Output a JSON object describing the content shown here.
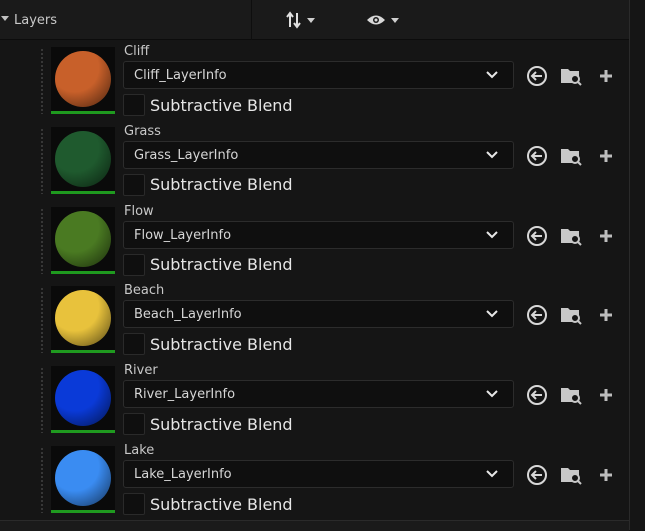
{
  "header": {
    "title": "Layers",
    "sort_icon": "sort-arrows-icon",
    "visibility_icon": "eye-icon"
  },
  "layers": [
    {
      "name": "Cliff",
      "layer_info": "Cliff_LayerInfo",
      "checkbox_label": "Subtractive Blend",
      "subtractive_blend": false,
      "color": "#c8602a"
    },
    {
      "name": "Grass",
      "layer_info": "Grass_LayerInfo",
      "checkbox_label": "Subtractive Blend",
      "subtractive_blend": false,
      "color": "#1f5a2e"
    },
    {
      "name": "Flow",
      "layer_info": "Flow_LayerInfo",
      "checkbox_label": "Subtractive Blend",
      "subtractive_blend": false,
      "color": "#4a7a22"
    },
    {
      "name": "Beach",
      "layer_info": "Beach_LayerInfo",
      "checkbox_label": "Subtractive Blend",
      "subtractive_blend": false,
      "color": "#e8c23c"
    },
    {
      "name": "River",
      "layer_info": "River_LayerInfo",
      "checkbox_label": "Subtractive Blend",
      "subtractive_blend": false,
      "color": "#0a3ad8"
    },
    {
      "name": "Lake",
      "layer_info": "Lake_LayerInfo",
      "checkbox_label": "Subtractive Blend",
      "subtractive_blend": false,
      "color": "#3a8cf2"
    }
  ],
  "row_icons": [
    "use-selected-asset-icon",
    "browse-folder-icon",
    "add-icon"
  ],
  "colors": {
    "accent_green": "#1f9a1f",
    "panel_bg": "#151515",
    "field_bg": "#0f0f0f"
  }
}
